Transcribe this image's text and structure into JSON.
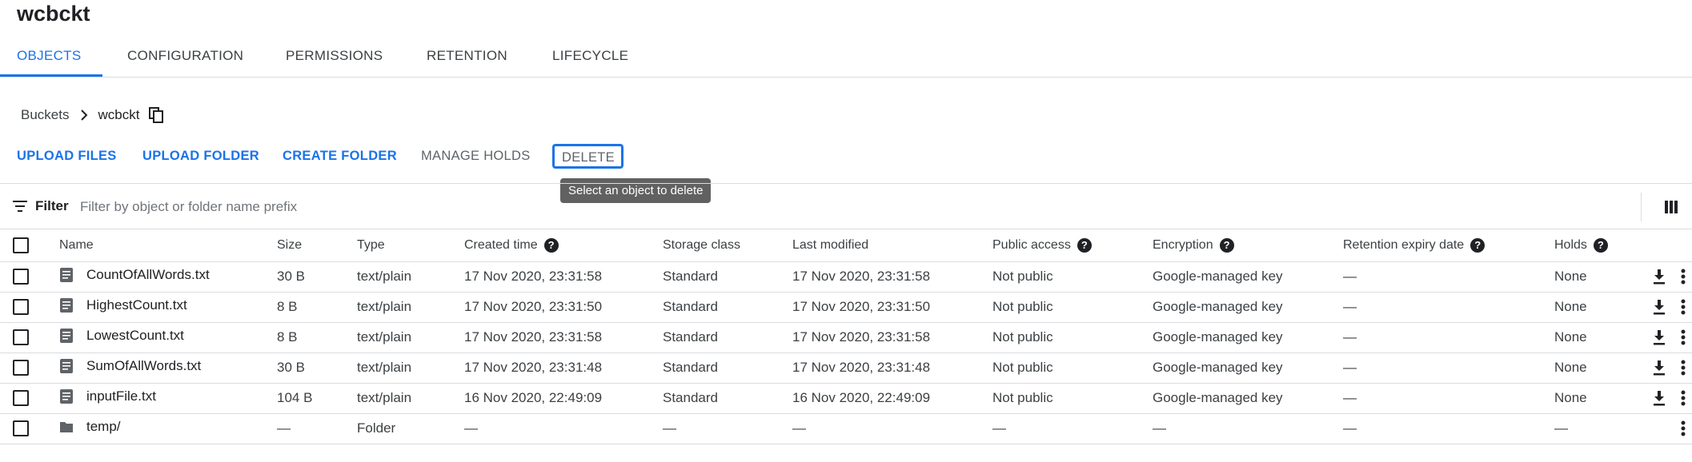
{
  "bucket": {
    "title": "wcbckt"
  },
  "tabs": [
    {
      "label": "OBJECTS",
      "active": true
    },
    {
      "label": "CONFIGURATION"
    },
    {
      "label": "PERMISSIONS"
    },
    {
      "label": "RETENTION"
    },
    {
      "label": "LIFECYCLE"
    }
  ],
  "breadcrumb": {
    "root": "Buckets",
    "current": "wcbckt"
  },
  "actions": {
    "upload_files": "UPLOAD FILES",
    "upload_folder": "UPLOAD FOLDER",
    "create_folder": "CREATE FOLDER",
    "manage_holds": "MANAGE HOLDS",
    "delete": "DELETE"
  },
  "tooltip": "Select an object to delete",
  "filter": {
    "label": "Filter",
    "placeholder": "Filter by object or folder name prefix"
  },
  "columns": {
    "name": "Name",
    "size": "Size",
    "type": "Type",
    "created": "Created time",
    "storage": "Storage class",
    "modified": "Last modified",
    "public": "Public access",
    "encryption": "Encryption",
    "retention": "Retention expiry date",
    "holds": "Holds"
  },
  "rows": [
    {
      "name": "CountOfAllWords.txt",
      "size": "30 B",
      "type": "text/plain",
      "created": "17 Nov 2020, 23:31:58",
      "storage": "Standard",
      "modified": "17 Nov 2020, 23:31:58",
      "public": "Not public",
      "encryption": "Google-managed key",
      "retention": "—",
      "holds": "None"
    },
    {
      "name": "HighestCount.txt",
      "size": "8 B",
      "type": "text/plain",
      "created": "17 Nov 2020, 23:31:50",
      "storage": "Standard",
      "modified": "17 Nov 2020, 23:31:50",
      "public": "Not public",
      "encryption": "Google-managed key",
      "retention": "—",
      "holds": "None"
    },
    {
      "name": "LowestCount.txt",
      "size": "8 B",
      "type": "text/plain",
      "created": "17 Nov 2020, 23:31:58",
      "storage": "Standard",
      "modified": "17 Nov 2020, 23:31:58",
      "public": "Not public",
      "encryption": "Google-managed key",
      "retention": "—",
      "holds": "None"
    },
    {
      "name": "SumOfAllWords.txt",
      "size": "30 B",
      "type": "text/plain",
      "created": "17 Nov 2020, 23:31:48",
      "storage": "Standard",
      "modified": "17 Nov 2020, 23:31:48",
      "public": "Not public",
      "encryption": "Google-managed key",
      "retention": "—",
      "holds": "None"
    },
    {
      "name": "inputFile.txt",
      "size": "104 B",
      "type": "text/plain",
      "created": "16 Nov 2020, 22:49:09",
      "storage": "Standard",
      "modified": "16 Nov 2020, 22:49:09",
      "public": "Not public",
      "encryption": "Google-managed key",
      "retention": "—",
      "holds": "None"
    },
    {
      "name": "temp/",
      "size": "—",
      "type": "Folder",
      "created": "—",
      "storage": "—",
      "modified": "—",
      "public": "—",
      "encryption": "—",
      "retention": "—",
      "holds": "—"
    }
  ]
}
